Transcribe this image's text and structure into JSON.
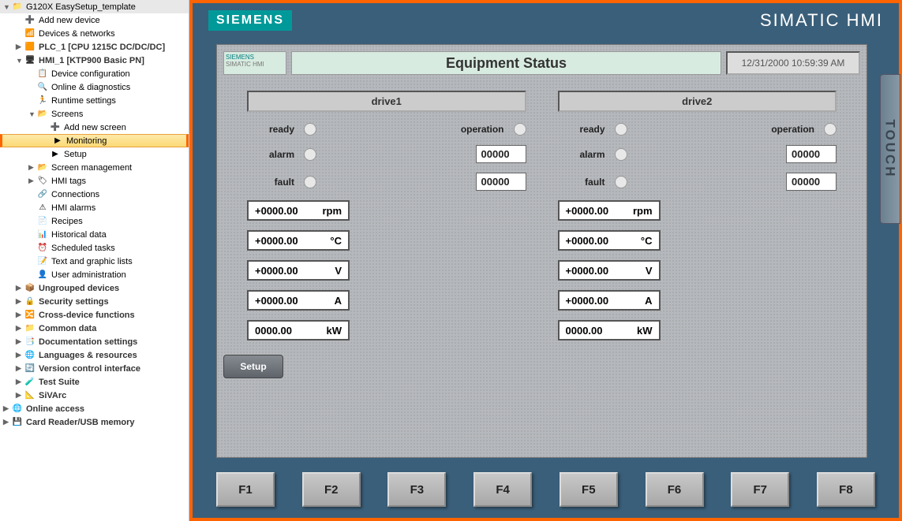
{
  "tree": [
    {
      "ind": 0,
      "arr": "▼",
      "ico": "📁",
      "txt": "G120X EasySetup_template",
      "bold": false
    },
    {
      "ind": 1,
      "arr": "",
      "ico": "➕",
      "txt": "Add new device"
    },
    {
      "ind": 1,
      "arr": "",
      "ico": "📶",
      "txt": "Devices & networks"
    },
    {
      "ind": 1,
      "arr": "▶",
      "ico": "🟧",
      "txt": "PLC_1 [CPU 1215C DC/DC/DC]",
      "bold": true
    },
    {
      "ind": 1,
      "arr": "▼",
      "ico": "🖥",
      "txt": "HMI_1 [KTP900 Basic PN]",
      "bold": true
    },
    {
      "ind": 2,
      "arr": "",
      "ico": "📋",
      "txt": "Device configuration"
    },
    {
      "ind": 2,
      "arr": "",
      "ico": "🔍",
      "txt": "Online & diagnostics"
    },
    {
      "ind": 2,
      "arr": "",
      "ico": "🏃",
      "txt": "Runtime settings"
    },
    {
      "ind": 2,
      "arr": "▼",
      "ico": "📂",
      "txt": "Screens"
    },
    {
      "ind": 3,
      "arr": "",
      "ico": "➕",
      "txt": "Add new screen"
    },
    {
      "ind": 3,
      "arr": "",
      "ico": "▶",
      "txt": "Monitoring",
      "sel": true
    },
    {
      "ind": 3,
      "arr": "",
      "ico": "▶",
      "txt": "Setup"
    },
    {
      "ind": 2,
      "arr": "▶",
      "ico": "📂",
      "txt": "Screen management"
    },
    {
      "ind": 2,
      "arr": "▶",
      "ico": "🏷",
      "txt": "HMI tags"
    },
    {
      "ind": 2,
      "arr": "",
      "ico": "🔗",
      "txt": "Connections"
    },
    {
      "ind": 2,
      "arr": "",
      "ico": "⚠",
      "txt": "HMI alarms"
    },
    {
      "ind": 2,
      "arr": "",
      "ico": "📄",
      "txt": "Recipes"
    },
    {
      "ind": 2,
      "arr": "",
      "ico": "📊",
      "txt": "Historical data"
    },
    {
      "ind": 2,
      "arr": "",
      "ico": "⏰",
      "txt": "Scheduled tasks"
    },
    {
      "ind": 2,
      "arr": "",
      "ico": "📝",
      "txt": "Text and graphic lists"
    },
    {
      "ind": 2,
      "arr": "",
      "ico": "👤",
      "txt": "User administration"
    },
    {
      "ind": 1,
      "arr": "▶",
      "ico": "📦",
      "txt": "Ungrouped devices",
      "bold": true
    },
    {
      "ind": 1,
      "arr": "▶",
      "ico": "🔒",
      "txt": "Security settings",
      "bold": true
    },
    {
      "ind": 1,
      "arr": "▶",
      "ico": "🔀",
      "txt": "Cross-device functions",
      "bold": true
    },
    {
      "ind": 1,
      "arr": "▶",
      "ico": "📁",
      "txt": "Common data",
      "bold": true
    },
    {
      "ind": 1,
      "arr": "▶",
      "ico": "📑",
      "txt": "Documentation settings",
      "bold": true
    },
    {
      "ind": 1,
      "arr": "▶",
      "ico": "🌐",
      "txt": "Languages & resources",
      "bold": true
    },
    {
      "ind": 1,
      "arr": "▶",
      "ico": "🔄",
      "txt": "Version control interface",
      "bold": true
    },
    {
      "ind": 1,
      "arr": "▶",
      "ico": "🧪",
      "txt": "Test Suite",
      "bold": true
    },
    {
      "ind": 1,
      "arr": "▶",
      "ico": "📐",
      "txt": "SiVArc",
      "bold": true
    },
    {
      "ind": 0,
      "arr": "▶",
      "ico": "🌐",
      "txt": "Online access",
      "bold": true
    },
    {
      "ind": 0,
      "arr": "▶",
      "ico": "💾",
      "txt": "Card Reader/USB memory",
      "bold": true
    }
  ],
  "header": {
    "logo": "SIEMENS",
    "title": "SIMATIC HMI",
    "touch": "TOUCH"
  },
  "screen": {
    "corner1": "SIEMENS",
    "corner2": "SIMATIC HMI",
    "title": "Equipment Status",
    "time": "12/31/2000 10:59:39 AM",
    "labels": {
      "ready": "ready",
      "operation": "operation",
      "alarm": "alarm",
      "fault": "fault"
    },
    "drives": [
      {
        "name": "drive1",
        "alarm_code": "00000",
        "fault_code": "00000",
        "meas": [
          {
            "v": "+0000.00",
            "u": "rpm"
          },
          {
            "v": "+0000.00",
            "u": "°C"
          },
          {
            "v": "+0000.00",
            "u": "V"
          },
          {
            "v": "+0000.00",
            "u": "A"
          },
          {
            "v": "0000.00",
            "u": "kW"
          }
        ]
      },
      {
        "name": "drive2",
        "alarm_code": "00000",
        "fault_code": "00000",
        "meas": [
          {
            "v": "+0000.00",
            "u": "rpm"
          },
          {
            "v": "+0000.00",
            "u": "°C"
          },
          {
            "v": "+0000.00",
            "u": "V"
          },
          {
            "v": "+0000.00",
            "u": "A"
          },
          {
            "v": "0000.00",
            "u": "kW"
          }
        ]
      }
    ],
    "setup": "Setup"
  },
  "fkeys": [
    "F1",
    "F2",
    "F3",
    "F4",
    "F5",
    "F6",
    "F7",
    "F8"
  ]
}
